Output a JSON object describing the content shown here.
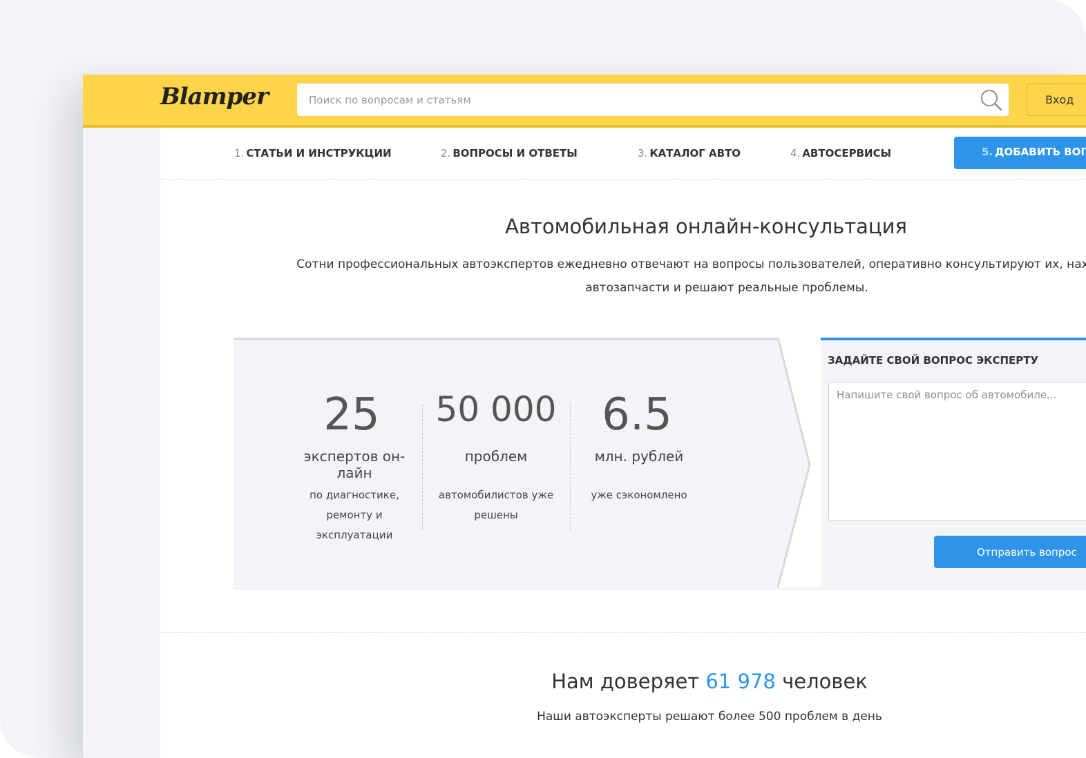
{
  "header": {
    "logo": "Blamper",
    "search_placeholder": "Поиск по вопросам и статьям",
    "login_label": "Вход"
  },
  "nav": {
    "items": [
      {
        "num": "1.",
        "label": "СТАТЬИ И ИНСТРУКЦИИ"
      },
      {
        "num": "2.",
        "label": "ВОПРОСЫ И ОТВЕТЫ"
      },
      {
        "num": "3.",
        "label": "КАТАЛОГ АВТО"
      },
      {
        "num": "4.",
        "label": "АВТОСЕРВИСЫ"
      },
      {
        "num": "5.",
        "label": "ДОБАВИТЬ ВОП"
      }
    ]
  },
  "hero": {
    "title": "Автомобильная онлайн-консультация",
    "description": "Сотни профессиональных автоэкспертов ежедневно отвечают на вопросы пользователей, оперативно консультируют их, наход нужные автозапчасти и решают реальные проблемы."
  },
  "stats": [
    {
      "value": "25",
      "unit": "экспертов он-лайн",
      "note": "по диагностике, ремонту и эксплуатации"
    },
    {
      "value": "50 000",
      "unit": "проблем",
      "note": "автомобилистов уже решены"
    },
    {
      "value": "6.5",
      "unit": "млн. рублей",
      "note": "уже сэкономлено"
    }
  ],
  "ask": {
    "title": "ЗАДАЙТЕ СВОЙ ВОПРОС ЭКСПЕРТУ",
    "placeholder": "Напишите свой вопрос об автомобиле...",
    "button": "Отправить вопрос"
  },
  "trust": {
    "prefix": "Нам доверяет",
    "count": "61 978",
    "suffix": "человек",
    "subtitle": "Наши автоэксперты решают более 500 проблем в день"
  },
  "colors": {
    "header_yellow": "#fdd44a",
    "accent_blue": "#2e94ea",
    "panel_gray": "#f3f4f7"
  }
}
